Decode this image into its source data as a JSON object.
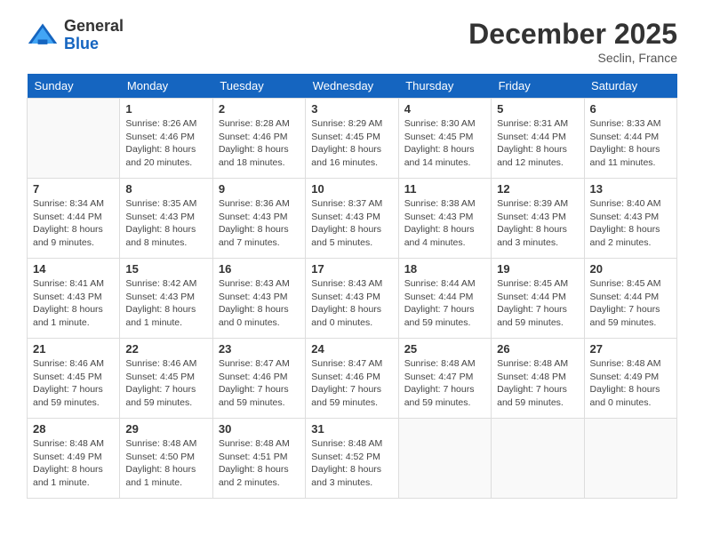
{
  "header": {
    "logo": {
      "general": "General",
      "blue": "Blue"
    },
    "title": "December 2025",
    "location": "Seclin, France"
  },
  "weekdays": [
    "Sunday",
    "Monday",
    "Tuesday",
    "Wednesday",
    "Thursday",
    "Friday",
    "Saturday"
  ],
  "weeks": [
    [
      {
        "day": "",
        "info": ""
      },
      {
        "day": "1",
        "sunrise": "Sunrise: 8:26 AM",
        "sunset": "Sunset: 4:46 PM",
        "daylight": "Daylight: 8 hours and 20 minutes."
      },
      {
        "day": "2",
        "sunrise": "Sunrise: 8:28 AM",
        "sunset": "Sunset: 4:46 PM",
        "daylight": "Daylight: 8 hours and 18 minutes."
      },
      {
        "day": "3",
        "sunrise": "Sunrise: 8:29 AM",
        "sunset": "Sunset: 4:45 PM",
        "daylight": "Daylight: 8 hours and 16 minutes."
      },
      {
        "day": "4",
        "sunrise": "Sunrise: 8:30 AM",
        "sunset": "Sunset: 4:45 PM",
        "daylight": "Daylight: 8 hours and 14 minutes."
      },
      {
        "day": "5",
        "sunrise": "Sunrise: 8:31 AM",
        "sunset": "Sunset: 4:44 PM",
        "daylight": "Daylight: 8 hours and 12 minutes."
      },
      {
        "day": "6",
        "sunrise": "Sunrise: 8:33 AM",
        "sunset": "Sunset: 4:44 PM",
        "daylight": "Daylight: 8 hours and 11 minutes."
      }
    ],
    [
      {
        "day": "7",
        "sunrise": "Sunrise: 8:34 AM",
        "sunset": "Sunset: 4:44 PM",
        "daylight": "Daylight: 8 hours and 9 minutes."
      },
      {
        "day": "8",
        "sunrise": "Sunrise: 8:35 AM",
        "sunset": "Sunset: 4:43 PM",
        "daylight": "Daylight: 8 hours and 8 minutes."
      },
      {
        "day": "9",
        "sunrise": "Sunrise: 8:36 AM",
        "sunset": "Sunset: 4:43 PM",
        "daylight": "Daylight: 8 hours and 7 minutes."
      },
      {
        "day": "10",
        "sunrise": "Sunrise: 8:37 AM",
        "sunset": "Sunset: 4:43 PM",
        "daylight": "Daylight: 8 hours and 5 minutes."
      },
      {
        "day": "11",
        "sunrise": "Sunrise: 8:38 AM",
        "sunset": "Sunset: 4:43 PM",
        "daylight": "Daylight: 8 hours and 4 minutes."
      },
      {
        "day": "12",
        "sunrise": "Sunrise: 8:39 AM",
        "sunset": "Sunset: 4:43 PM",
        "daylight": "Daylight: 8 hours and 3 minutes."
      },
      {
        "day": "13",
        "sunrise": "Sunrise: 8:40 AM",
        "sunset": "Sunset: 4:43 PM",
        "daylight": "Daylight: 8 hours and 2 minutes."
      }
    ],
    [
      {
        "day": "14",
        "sunrise": "Sunrise: 8:41 AM",
        "sunset": "Sunset: 4:43 PM",
        "daylight": "Daylight: 8 hours and 1 minute."
      },
      {
        "day": "15",
        "sunrise": "Sunrise: 8:42 AM",
        "sunset": "Sunset: 4:43 PM",
        "daylight": "Daylight: 8 hours and 1 minute."
      },
      {
        "day": "16",
        "sunrise": "Sunrise: 8:43 AM",
        "sunset": "Sunset: 4:43 PM",
        "daylight": "Daylight: 8 hours and 0 minutes."
      },
      {
        "day": "17",
        "sunrise": "Sunrise: 8:43 AM",
        "sunset": "Sunset: 4:43 PM",
        "daylight": "Daylight: 8 hours and 0 minutes."
      },
      {
        "day": "18",
        "sunrise": "Sunrise: 8:44 AM",
        "sunset": "Sunset: 4:44 PM",
        "daylight": "Daylight: 7 hours and 59 minutes."
      },
      {
        "day": "19",
        "sunrise": "Sunrise: 8:45 AM",
        "sunset": "Sunset: 4:44 PM",
        "daylight": "Daylight: 7 hours and 59 minutes."
      },
      {
        "day": "20",
        "sunrise": "Sunrise: 8:45 AM",
        "sunset": "Sunset: 4:44 PM",
        "daylight": "Daylight: 7 hours and 59 minutes."
      }
    ],
    [
      {
        "day": "21",
        "sunrise": "Sunrise: 8:46 AM",
        "sunset": "Sunset: 4:45 PM",
        "daylight": "Daylight: 7 hours and 59 minutes."
      },
      {
        "day": "22",
        "sunrise": "Sunrise: 8:46 AM",
        "sunset": "Sunset: 4:45 PM",
        "daylight": "Daylight: 7 hours and 59 minutes."
      },
      {
        "day": "23",
        "sunrise": "Sunrise: 8:47 AM",
        "sunset": "Sunset: 4:46 PM",
        "daylight": "Daylight: 7 hours and 59 minutes."
      },
      {
        "day": "24",
        "sunrise": "Sunrise: 8:47 AM",
        "sunset": "Sunset: 4:46 PM",
        "daylight": "Daylight: 7 hours and 59 minutes."
      },
      {
        "day": "25",
        "sunrise": "Sunrise: 8:48 AM",
        "sunset": "Sunset: 4:47 PM",
        "daylight": "Daylight: 7 hours and 59 minutes."
      },
      {
        "day": "26",
        "sunrise": "Sunrise: 8:48 AM",
        "sunset": "Sunset: 4:48 PM",
        "daylight": "Daylight: 7 hours and 59 minutes."
      },
      {
        "day": "27",
        "sunrise": "Sunrise: 8:48 AM",
        "sunset": "Sunset: 4:49 PM",
        "daylight": "Daylight: 8 hours and 0 minutes."
      }
    ],
    [
      {
        "day": "28",
        "sunrise": "Sunrise: 8:48 AM",
        "sunset": "Sunset: 4:49 PM",
        "daylight": "Daylight: 8 hours and 1 minute."
      },
      {
        "day": "29",
        "sunrise": "Sunrise: 8:48 AM",
        "sunset": "Sunset: 4:50 PM",
        "daylight": "Daylight: 8 hours and 1 minute."
      },
      {
        "day": "30",
        "sunrise": "Sunrise: 8:48 AM",
        "sunset": "Sunset: 4:51 PM",
        "daylight": "Daylight: 8 hours and 2 minutes."
      },
      {
        "day": "31",
        "sunrise": "Sunrise: 8:48 AM",
        "sunset": "Sunset: 4:52 PM",
        "daylight": "Daylight: 8 hours and 3 minutes."
      },
      {
        "day": "",
        "info": ""
      },
      {
        "day": "",
        "info": ""
      },
      {
        "day": "",
        "info": ""
      }
    ]
  ]
}
